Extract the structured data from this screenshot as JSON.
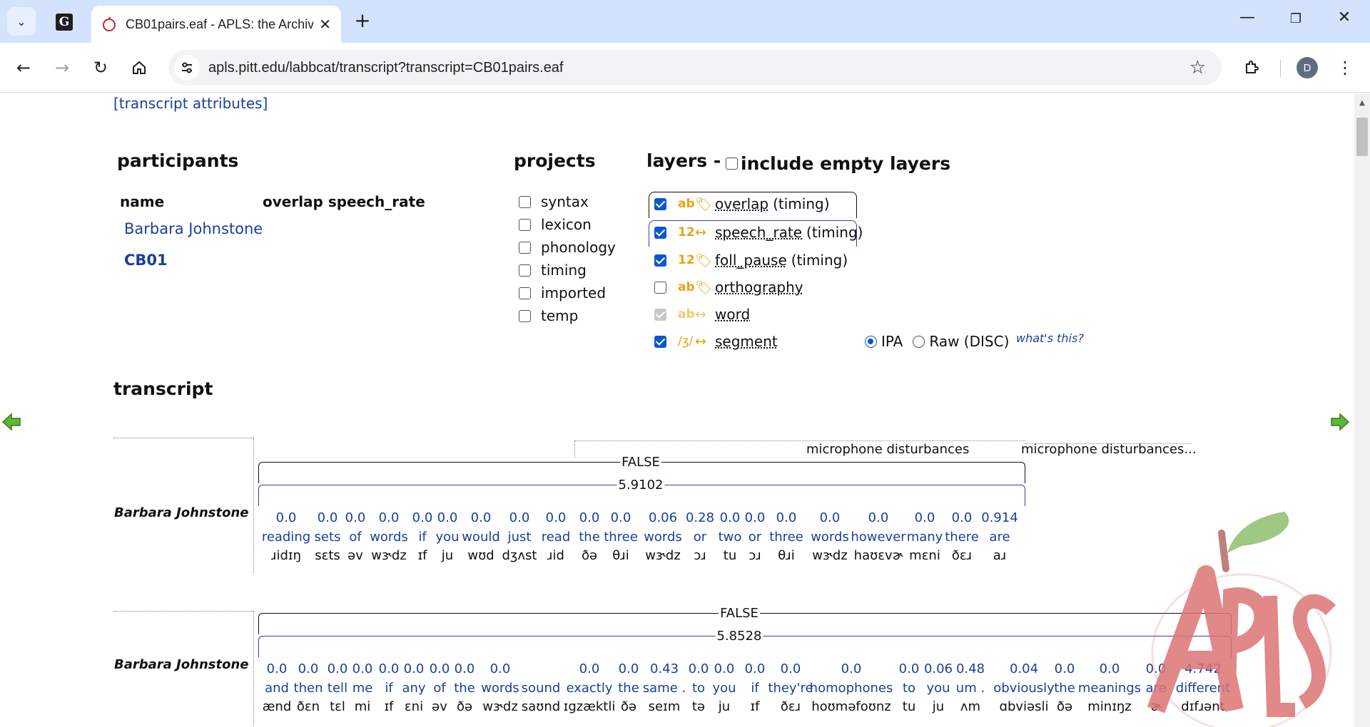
{
  "browser": {
    "tab_title": "CB01pairs.eaf - APLS: the Archiv",
    "url": "apls.pitt.edu/labbcat/transcript?transcript=CB01pairs.eaf",
    "profile_initial": "D",
    "pinned_tab_letter": "G"
  },
  "page": {
    "attributes_link": "[transcript attributes]",
    "participants": {
      "heading": "participants",
      "col_name": "name",
      "col_attrs": "overlap speech_rate",
      "people": [
        "Barbara Johnstone",
        "CB01"
      ]
    },
    "projects": {
      "heading": "projects",
      "items": [
        "syntax",
        "lexicon",
        "phonology",
        "timing",
        "imported",
        "temp"
      ]
    },
    "layers": {
      "heading": "layers -",
      "include_empty_label": "include empty layers",
      "items": [
        {
          "type": "ab",
          "name": "overlap",
          "suffix": "(timing)",
          "checked": true,
          "icon": "tag-icon"
        },
        {
          "type": "12",
          "name": "speech_rate",
          "suffix": "(timing)",
          "checked": true,
          "icon": "interval-icon"
        },
        {
          "type": "12",
          "name": "foll_pause",
          "suffix": "(timing)",
          "checked": true,
          "icon": "tag-icon"
        },
        {
          "type": "ab",
          "name": "orthography",
          "suffix": "",
          "checked": false,
          "icon": "tag-icon"
        },
        {
          "type": "ab",
          "name": "word",
          "suffix": "",
          "checked": true,
          "icon": "interval-icon"
        },
        {
          "type": "/ʒ/",
          "name": "segment",
          "suffix": "",
          "checked": true,
          "icon": "interval-icon"
        }
      ],
      "ipa_label": "IPA",
      "raw_label": "Raw (DISC)",
      "whats_this": "what's this?"
    },
    "transcript_heading": "transcript",
    "lines": [
      {
        "speaker": "Barbara Johnstone",
        "noise_1": "microphone disturbances",
        "noise_2": "microphone disturbances...",
        "overlap": "FALSE",
        "speech_rate": "5.9102",
        "words": [
          {
            "r": "0.0",
            "o": "reading",
            "s": "ɹidɪŋ"
          },
          {
            "r": "0.0",
            "o": "sets",
            "s": "sɛts"
          },
          {
            "r": "0.0",
            "o": "of",
            "s": "əv"
          },
          {
            "r": "0.0",
            "o": "words",
            "s": "wɝdz"
          },
          {
            "r": "0.0",
            "o": "if",
            "s": "ɪf"
          },
          {
            "r": "0.0",
            "o": "you",
            "s": "ju"
          },
          {
            "r": "0.0",
            "o": "would",
            "s": "wʊd"
          },
          {
            "r": "0.0",
            "o": "just",
            "s": "dʒʌst"
          },
          {
            "r": "0.0",
            "o": "read",
            "s": "ɹid"
          },
          {
            "r": "0.0",
            "o": "the",
            "s": "ðə"
          },
          {
            "r": "0.0",
            "o": "three",
            "s": "θɹi"
          },
          {
            "r": "0.06",
            "o": "words",
            "s": "wɝdz"
          },
          {
            "r": "0.28",
            "o": "or",
            "s": "ɔɹ"
          },
          {
            "r": "0.0",
            "o": "two",
            "s": "tu"
          },
          {
            "r": "0.0",
            "o": "or",
            "s": "ɔɹ"
          },
          {
            "r": "0.0",
            "o": "three",
            "s": "θɹi"
          },
          {
            "r": "0.0",
            "o": "words",
            "s": "wɝdz"
          },
          {
            "r": "0.0",
            "o": "however",
            "s": "haʊɛvɚ"
          },
          {
            "r": "0.0",
            "o": "many",
            "s": "mɛni"
          },
          {
            "r": "0.0",
            "o": "there",
            "s": "ðɛɹ"
          },
          {
            "r": "0.914",
            "o": "are",
            "s": "aɹ"
          }
        ]
      },
      {
        "speaker": "Barbara Johnstone",
        "overlap": "FALSE",
        "speech_rate": "5.8528",
        "words": [
          {
            "r": "0.0",
            "o": "and",
            "s": "ænd"
          },
          {
            "r": "0.0",
            "o": "then",
            "s": "ðɛn"
          },
          {
            "r": "0.0",
            "o": "tell",
            "s": "tɛl"
          },
          {
            "r": "0.0",
            "o": "me",
            "s": "mi"
          },
          {
            "r": "0.0",
            "o": "if",
            "s": "ɪf"
          },
          {
            "r": "0.0",
            "o": "any",
            "s": "ɛni"
          },
          {
            "r": "0.0",
            "o": "of",
            "s": "əv"
          },
          {
            "r": "0.0",
            "o": "the",
            "s": "ðə"
          },
          {
            "r": "0.0",
            "o": "words",
            "s": "wɝdz"
          },
          {
            "r": "",
            "o": "sound",
            "s": "saʊnd"
          },
          {
            "r": "0.0",
            "o": "exactly",
            "s": "ɪgzæktli"
          },
          {
            "r": "0.0",
            "o": "the",
            "s": "ðə"
          },
          {
            "r": "0.43",
            "o": "same .",
            "s": "seɪm"
          },
          {
            "r": "0.0",
            "o": "to",
            "s": "tə"
          },
          {
            "r": "0.0",
            "o": "you",
            "s": "ju"
          },
          {
            "r": "0.0",
            "o": "if",
            "s": "ɪf"
          },
          {
            "r": "0.0",
            "o": "they're",
            "s": "ðɛɹ"
          },
          {
            "r": "0.0",
            "o": "homophones",
            "s": "hoʊməfoʊnz"
          },
          {
            "r": "0.0",
            "o": "to",
            "s": "tu"
          },
          {
            "r": "0.06",
            "o": "you",
            "s": "ju"
          },
          {
            "r": "0.48",
            "o": "um .",
            "s": "ʌm"
          },
          {
            "r": "0.04",
            "o": "obviously",
            "s": "ɑbviəsli"
          },
          {
            "r": "0.0",
            "o": "the",
            "s": "ðə"
          },
          {
            "r": "0.0",
            "o": "meanings",
            "s": "minɪŋz"
          },
          {
            "r": "0.0",
            "o": "are",
            "s": "ɚ"
          },
          {
            "r": "4.742",
            "o": "different",
            "s": "dɪfɹənt"
          }
        ]
      }
    ],
    "logo_text": "APLS"
  }
}
